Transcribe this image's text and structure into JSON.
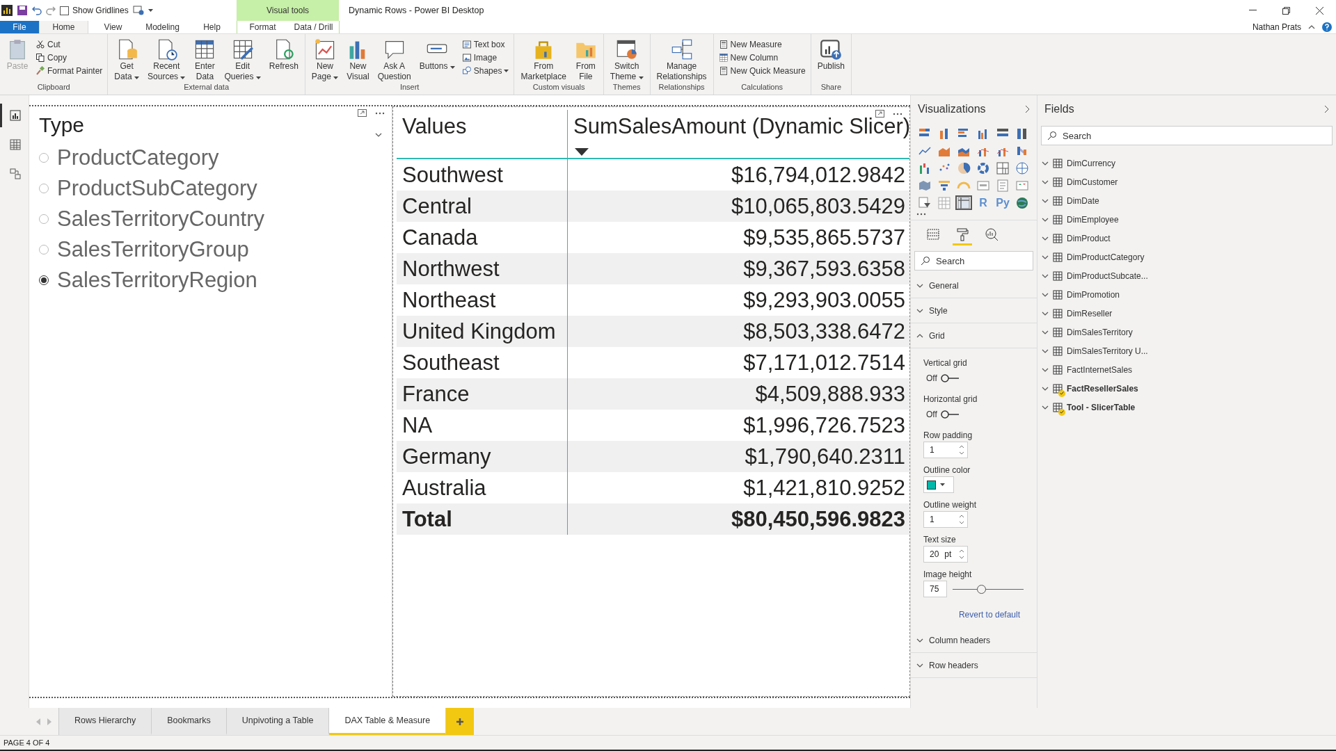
{
  "window": {
    "title": "Dynamic Rows - Power BI Desktop",
    "user": "Nathan Prats"
  },
  "quick_access": {
    "show_gridlines": {
      "label": "Show Gridlines",
      "checked": false
    }
  },
  "context_group": "Visual tools",
  "ribbon_tabs": [
    {
      "label": "File",
      "kind": "file",
      "selected": false
    },
    {
      "label": "Home",
      "kind": "normal",
      "selected": true
    },
    {
      "label": "View",
      "kind": "normal",
      "selected": false
    },
    {
      "label": "Modeling",
      "kind": "normal",
      "selected": false
    },
    {
      "label": "Help",
      "kind": "normal",
      "selected": false
    },
    {
      "label": "Format",
      "kind": "context",
      "selected": false
    },
    {
      "label": "Data / Drill",
      "kind": "context",
      "selected": false
    }
  ],
  "ribbon_groups": [
    {
      "label": "Clipboard",
      "items": [
        {
          "kind": "large",
          "lines": [
            "Paste"
          ],
          "disabled": true,
          "dropdown": false
        },
        {
          "kind": "stack",
          "items": [
            {
              "label": "Cut",
              "dropdown": false
            },
            {
              "label": "Copy",
              "dropdown": false
            },
            {
              "label": "Format Painter",
              "dropdown": false
            }
          ]
        }
      ]
    },
    {
      "label": "External data",
      "items": [
        {
          "kind": "large",
          "lines": [
            "Get",
            "Data"
          ],
          "disabled": false,
          "dropdown": true
        },
        {
          "kind": "large",
          "lines": [
            "Recent",
            "Sources"
          ],
          "disabled": false,
          "dropdown": true
        },
        {
          "kind": "large",
          "lines": [
            "Enter",
            "Data"
          ],
          "disabled": false,
          "dropdown": false
        },
        {
          "kind": "large",
          "lines": [
            "Edit",
            "Queries"
          ],
          "disabled": false,
          "dropdown": true
        },
        {
          "kind": "large",
          "lines": [
            "Refresh"
          ],
          "disabled": false,
          "dropdown": false
        }
      ]
    },
    {
      "label": "Insert",
      "items": [
        {
          "kind": "large",
          "lines": [
            "New",
            "Page"
          ],
          "disabled": false,
          "dropdown": true
        },
        {
          "kind": "large",
          "lines": [
            "New",
            "Visual"
          ],
          "disabled": false,
          "dropdown": false
        },
        {
          "kind": "large",
          "lines": [
            "Ask A",
            "Question"
          ],
          "disabled": false,
          "dropdown": false
        },
        {
          "kind": "large",
          "lines": [
            "Buttons"
          ],
          "disabled": false,
          "dropdown": true
        },
        {
          "kind": "stack",
          "items": [
            {
              "label": "Text box",
              "dropdown": false
            },
            {
              "label": "Image",
              "dropdown": false
            },
            {
              "label": "Shapes",
              "dropdown": true
            }
          ]
        }
      ]
    },
    {
      "label": "Custom visuals",
      "items": [
        {
          "kind": "large",
          "lines": [
            "From",
            "Marketplace"
          ],
          "disabled": false,
          "dropdown": false
        },
        {
          "kind": "large",
          "lines": [
            "From",
            "File"
          ],
          "disabled": false,
          "dropdown": false
        }
      ]
    },
    {
      "label": "Themes",
      "items": [
        {
          "kind": "large",
          "lines": [
            "Switch",
            "Theme"
          ],
          "disabled": false,
          "dropdown": true
        }
      ]
    },
    {
      "label": "Relationships",
      "items": [
        {
          "kind": "large",
          "lines": [
            "Manage",
            "Relationships"
          ],
          "disabled": false,
          "dropdown": false
        }
      ]
    },
    {
      "label": "Calculations",
      "items": [
        {
          "kind": "stack",
          "items": [
            {
              "label": "New Measure",
              "dropdown": false
            },
            {
              "label": "New Column",
              "dropdown": false
            },
            {
              "label": "New Quick Measure",
              "dropdown": false
            }
          ]
        }
      ]
    },
    {
      "label": "Share",
      "items": [
        {
          "kind": "large",
          "lines": [
            "Publish"
          ],
          "disabled": false,
          "dropdown": false
        }
      ]
    }
  ],
  "nav": [
    {
      "kind": "report",
      "selected": true
    },
    {
      "kind": "data",
      "selected": false
    },
    {
      "kind": "model",
      "selected": false
    }
  ],
  "slicer": {
    "title": "Type",
    "items": [
      {
        "label": "ProductCategory",
        "selected": false
      },
      {
        "label": "ProductSubCategory",
        "selected": false
      },
      {
        "label": "SalesTerritoryCountry",
        "selected": false
      },
      {
        "label": "SalesTerritoryGroup",
        "selected": false
      },
      {
        "label": "SalesTerritoryRegion",
        "selected": true
      }
    ]
  },
  "table": {
    "columns": [
      {
        "label": "Values",
        "sorted": false
      },
      {
        "label": "SumSalesAmount (Dynamic Slicer)",
        "sorted": true
      }
    ],
    "rows": [
      [
        "Southwest",
        "$16,794,012.9842"
      ],
      [
        "Central",
        "$10,065,803.5429"
      ],
      [
        "Canada",
        "$9,535,865.5737"
      ],
      [
        "Northwest",
        "$9,367,593.6358"
      ],
      [
        "Northeast",
        "$9,293,903.0055"
      ],
      [
        "United Kingdom",
        "$8,503,338.6472"
      ],
      [
        "Southeast",
        "$7,171,012.7514"
      ],
      [
        "France",
        "$4,509,888.933"
      ],
      [
        "NA",
        "$1,996,726.7523"
      ],
      [
        "Germany",
        "$1,790,640.2311"
      ],
      [
        "Australia",
        "$1,421,810.9252"
      ]
    ],
    "total": [
      "Total",
      "$80,450,596.9823"
    ]
  },
  "visualizations": {
    "title": "Visualizations",
    "gallery": [
      {
        "kind": "stacked-bar",
        "selected": false
      },
      {
        "kind": "stacked-column",
        "selected": false
      },
      {
        "kind": "clustered-bar",
        "selected": false
      },
      {
        "kind": "clustered-column",
        "selected": false
      },
      {
        "kind": "full-bar",
        "selected": false
      },
      {
        "kind": "full-column",
        "selected": false
      },
      {
        "kind": "line",
        "selected": false
      },
      {
        "kind": "area",
        "selected": false
      },
      {
        "kind": "stacked-area",
        "selected": false
      },
      {
        "kind": "line-column",
        "selected": false
      },
      {
        "kind": "line-clustered",
        "selected": false
      },
      {
        "kind": "ribbon",
        "selected": false
      },
      {
        "kind": "waterfall",
        "selected": false
      },
      {
        "kind": "scatter",
        "selected": false
      },
      {
        "kind": "pie",
        "selected": false
      },
      {
        "kind": "donut",
        "selected": false
      },
      {
        "kind": "treemap",
        "selected": false
      },
      {
        "kind": "map",
        "selected": false
      },
      {
        "kind": "filled-map",
        "selected": false
      },
      {
        "kind": "funnel",
        "selected": false
      },
      {
        "kind": "gauge",
        "selected": false
      },
      {
        "kind": "card",
        "selected": false
      },
      {
        "kind": "multi-card",
        "selected": false
      },
      {
        "kind": "kpi",
        "selected": false
      },
      {
        "kind": "slicer",
        "selected": false
      },
      {
        "kind": "table",
        "selected": false
      },
      {
        "kind": "matrix",
        "selected": true
      },
      {
        "kind": "text",
        "label": "R",
        "selected": false
      },
      {
        "kind": "text",
        "label": "Py",
        "selected": false
      },
      {
        "kind": "globe",
        "selected": false
      }
    ],
    "pane_tabs": [
      {
        "kind": "fields",
        "selected": false
      },
      {
        "kind": "format",
        "selected": true
      },
      {
        "kind": "analytics",
        "selected": false
      }
    ],
    "search": {
      "placeholder": "Search"
    },
    "sections": [
      {
        "label": "General",
        "expanded": false
      },
      {
        "label": "Style",
        "expanded": false
      },
      {
        "label": "Grid",
        "expanded": true,
        "settings": [
          {
            "kind": "toggle",
            "label": "Vertical grid",
            "on": false,
            "state_text": "Off"
          },
          {
            "kind": "toggle",
            "label": "Horizontal grid",
            "on": false,
            "state_text": "Off"
          },
          {
            "kind": "spinner",
            "label": "Row padding",
            "value": "1"
          },
          {
            "kind": "color",
            "label": "Outline color",
            "color": "#01b8aa"
          },
          {
            "kind": "spinner",
            "label": "Outline weight",
            "value": "1"
          },
          {
            "kind": "spinner",
            "label": "Text size",
            "value": "20",
            "unit": "pt"
          },
          {
            "kind": "slider",
            "label": "Image height",
            "value": "75",
            "level": 0.4
          }
        ],
        "revert": "Revert to default"
      },
      {
        "label": "Column headers",
        "expanded": false
      },
      {
        "label": "Row headers",
        "expanded": false
      }
    ]
  },
  "fields": {
    "title": "Fields",
    "search": {
      "placeholder": "Search"
    },
    "tables": [
      {
        "label": "DimCurrency",
        "checked": false
      },
      {
        "label": "DimCustomer",
        "checked": false
      },
      {
        "label": "DimDate",
        "checked": false
      },
      {
        "label": "DimEmployee",
        "checked": false
      },
      {
        "label": "DimProduct",
        "checked": false
      },
      {
        "label": "DimProductCategory",
        "checked": false
      },
      {
        "label": "DimProductSubcate...",
        "checked": false
      },
      {
        "label": "DimPromotion",
        "checked": false
      },
      {
        "label": "DimReseller",
        "checked": false
      },
      {
        "label": "DimSalesTerritory",
        "checked": false
      },
      {
        "label": "DimSalesTerritory U...",
        "checked": false
      },
      {
        "label": "FactInternetSales",
        "checked": false
      },
      {
        "label": "FactResellerSales",
        "checked": true
      },
      {
        "label": "Tool - SlicerTable",
        "checked": true
      }
    ]
  },
  "page_tabs": [
    {
      "label": "Rows Hierarchy",
      "selected": false
    },
    {
      "label": "Bookmarks",
      "selected": false
    },
    {
      "label": "Unpivoting a Table",
      "selected": false
    },
    {
      "label": "DAX Table & Measure",
      "selected": true
    }
  ],
  "status": "PAGE 4 OF 4"
}
